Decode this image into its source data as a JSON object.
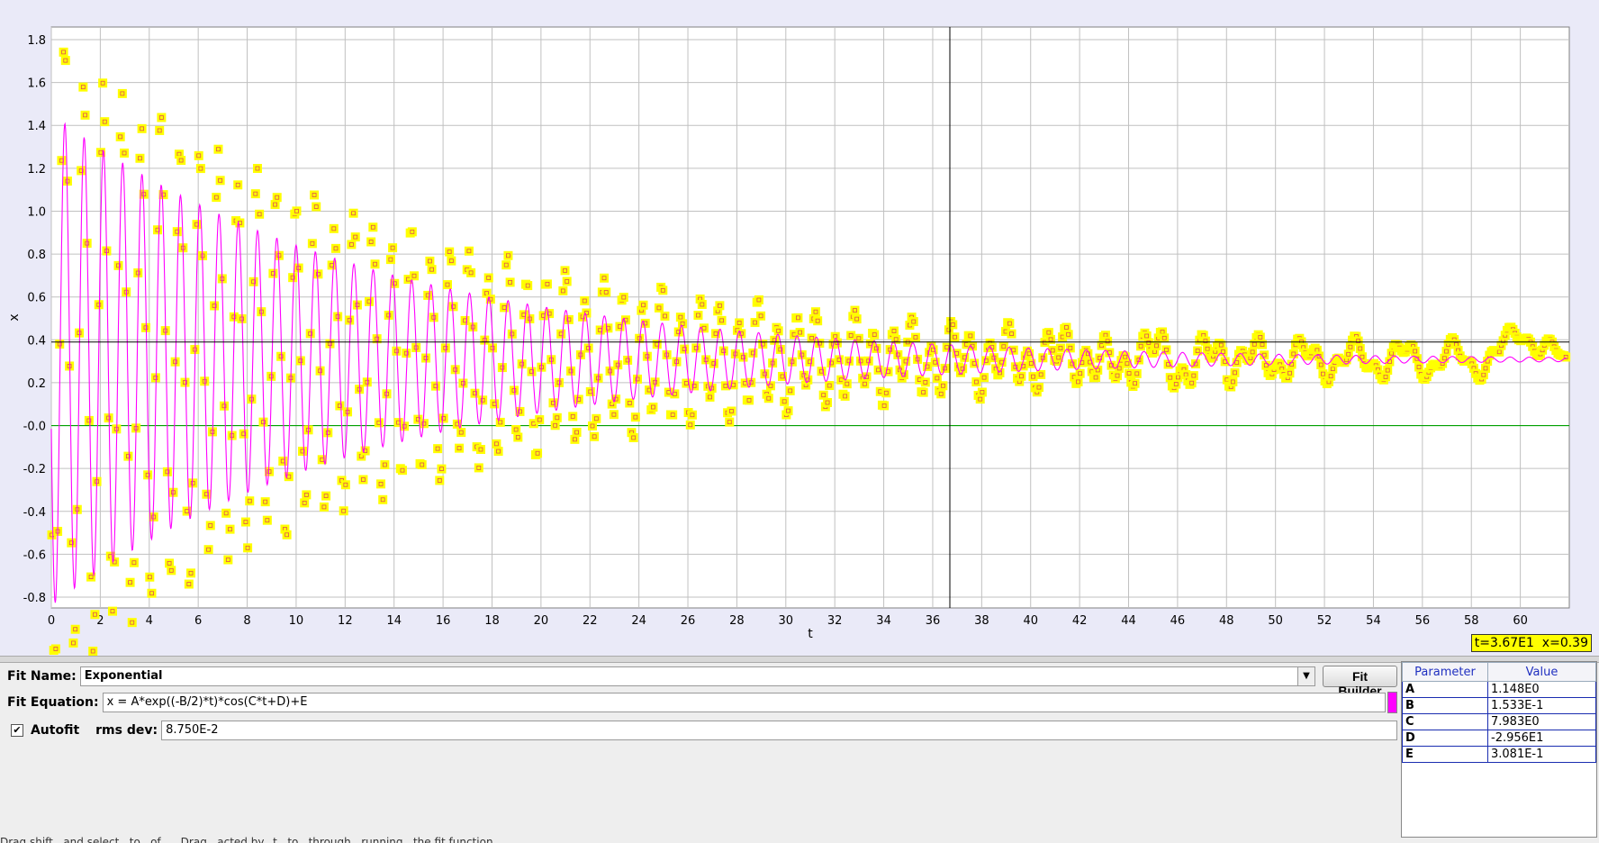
{
  "chart_data": {
    "type": "scatter",
    "xlabel": "t",
    "ylabel": "x",
    "xlim": [
      0,
      62
    ],
    "ylim": [
      -0.9,
      1.9
    ],
    "x_ticks": [
      "0",
      "2",
      "4",
      "6",
      "8",
      "10",
      "12",
      "14",
      "16",
      "18",
      "20",
      "22",
      "24",
      "26",
      "28",
      "30",
      "32",
      "34",
      "36",
      "38",
      "40",
      "42",
      "44",
      "46",
      "48",
      "50",
      "52",
      "54",
      "56",
      "58",
      "60"
    ],
    "y_ticks": [
      "1.8",
      "1.6",
      "1.4",
      "1.2",
      "1.0",
      "0.8",
      "0.6",
      "0.4",
      "0.2",
      "-0.0",
      "-0.2",
      "-0.4",
      "-0.6",
      "-0.8"
    ],
    "grid": true,
    "cursor": {
      "t": 36.7,
      "x": 0.39
    },
    "fit": {
      "A": 1.148,
      "B": 0.1533,
      "C": 7.983,
      "D": -29.56,
      "E": 0.3081
    },
    "colors": {
      "data": "#ffff00",
      "data_marker": "#e05050",
      "fit_curve": "#ff00ff",
      "zero_line": "#00a000",
      "background": "#ffffff",
      "grid": "#c0c0c0"
    }
  },
  "readout": "t=3.67E1  x=0.39",
  "fit_panel": {
    "fit_name_label": "Fit Name:",
    "fit_name_value": "Exponential",
    "fit_builder_label": "Fit Builder",
    "fit_equation_label": "Fit Equation:",
    "fit_equation_value": "x = A*exp((-B/2)*t)*cos(C*t+D)+E",
    "autofit_label": "Autofit",
    "autofit_checked": "✔",
    "rms_label": "rms dev:",
    "rms_value": "8.750E-2"
  },
  "param_table": {
    "headers": [
      "Parameter",
      "Value"
    ],
    "rows": [
      {
        "name": "A",
        "value": "1.148E0"
      },
      {
        "name": "B",
        "value": "1.533E-1"
      },
      {
        "name": "C",
        "value": "7.983E0"
      },
      {
        "name": "D",
        "value": "-2.956E1"
      },
      {
        "name": "E",
        "value": "3.081E-1"
      }
    ]
  },
  "status_text": "Drag shift...and select...to...of......Drag...acted by...t...to...through...running...the fit function"
}
